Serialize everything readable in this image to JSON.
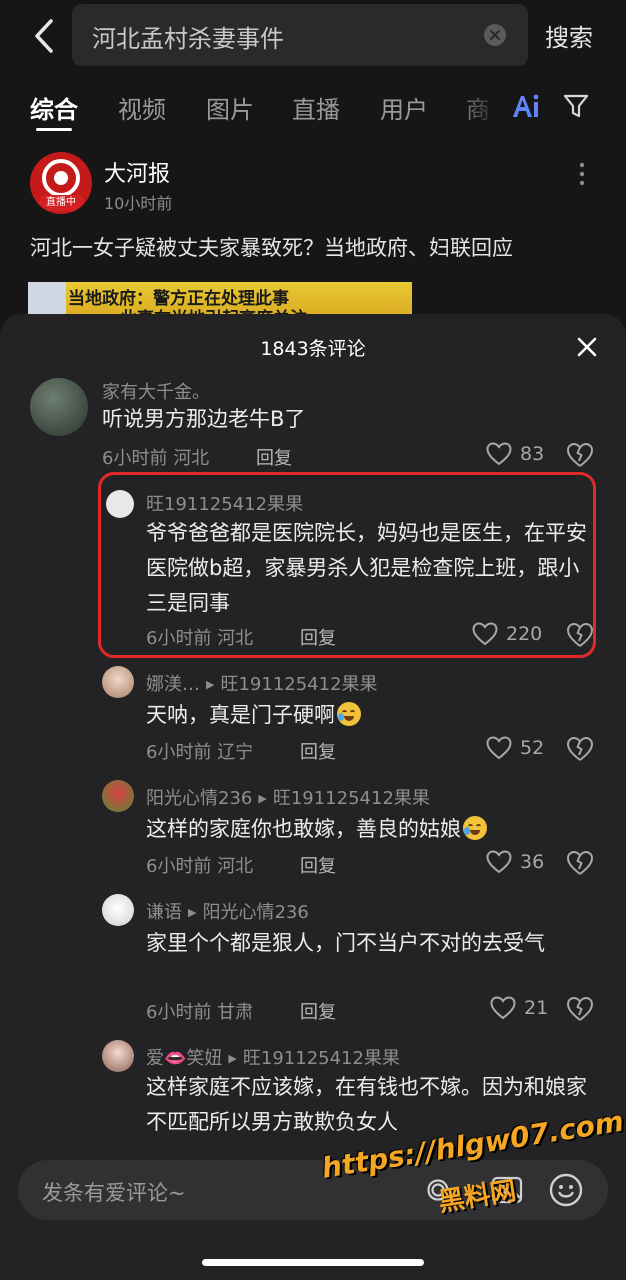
{
  "search": {
    "query": "河北孟村杀妻事件",
    "button_label": "搜索"
  },
  "tabs": [
    {
      "label": "综合",
      "active": true
    },
    {
      "label": "视频",
      "active": false
    },
    {
      "label": "图片",
      "active": false
    },
    {
      "label": "直播",
      "active": false
    },
    {
      "label": "用户",
      "active": false
    },
    {
      "label": "商",
      "active": false
    }
  ],
  "post": {
    "author": "大河报",
    "live_badge": "直播中",
    "time": "10小时前",
    "title": "河北一女子疑被丈夫家暴致死？当地政府、妇联回应",
    "thumb_line1": "当地政府：警方正在处理此事",
    "thumb_line2": "此事在当地引起高度关注"
  },
  "sheet": {
    "title": "1843条评论",
    "reply_label": "回复"
  },
  "comments": [
    {
      "name": "家有大千金。",
      "reply_to": "",
      "text": "听说男方那边老牛B了",
      "time": "6小时前",
      "region": "河北",
      "likes": "83"
    },
    {
      "name": "旺191125412果果",
      "reply_to": "",
      "text": "爷爷爸爸都是医院院长，妈妈也是医生，在平安医院做b超，家暴男杀人犯是检查院上班，跟小三是同事",
      "time": "6小时前",
      "region": "河北",
      "likes": "220"
    },
    {
      "name": "娜渼…",
      "reply_to": "旺191125412果果",
      "text": "天呐，真是门子硬啊",
      "time": "6小时前",
      "region": "辽宁",
      "likes": "52"
    },
    {
      "name": "阳光心情236",
      "reply_to": "旺191125412果果",
      "text": "这样的家庭你也敢嫁，善良的姑娘",
      "time": "6小时前",
      "region": "河北",
      "likes": "36"
    },
    {
      "name": "谦语",
      "reply_to": "阳光心情236",
      "text": "家里个个都是狠人，门不当户不对的去受气",
      "time": "6小时前",
      "region": "甘肃",
      "likes": "21"
    },
    {
      "name": "爱👄笑妞",
      "reply_to": "旺191125412果果",
      "text": "这样家庭不应该嫁，在有钱也不嫁。因为和娘家不匹配所以男方敢欺负女人",
      "time": "",
      "region": "",
      "likes": ""
    }
  ],
  "input": {
    "placeholder": "发条有爱评论~"
  },
  "watermark": {
    "url": "https://hlgw07.com",
    "name": "黑料网"
  },
  "colors": {
    "background": "#161616",
    "sheet": "#232325",
    "highlight_border": "#e02a2a",
    "watermark": "#f5a623"
  }
}
